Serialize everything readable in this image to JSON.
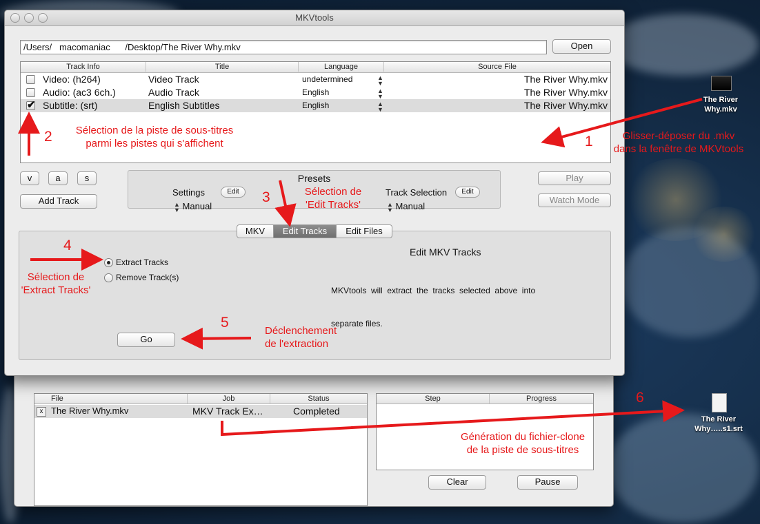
{
  "window": {
    "title": "MKVtools",
    "path_value": "/Users/   macomaniac      /Desktop/The River Why.mkv",
    "open_label": "Open"
  },
  "tracks": {
    "columns": [
      "Track Info",
      "Title",
      "Language",
      "Source File"
    ],
    "rows": [
      {
        "info": "Video: (h264)",
        "title": "Video Track",
        "language": "undetermined",
        "source": "The River Why.mkv",
        "checked": false
      },
      {
        "info": "Audio: (ac3 6ch.)",
        "title": "Audio Track",
        "language": "English",
        "source": "The River Why.mkv",
        "checked": false
      },
      {
        "info": "Subtitle: (srt)",
        "title": "English Subtitles",
        "language": "English",
        "source": "The River Why.mkv",
        "checked": true
      }
    ]
  },
  "buttons": {
    "v": "v",
    "a": "a",
    "s": "s",
    "add_track": "Add Track",
    "play": "Play",
    "watch_mode": "Watch Mode",
    "go": "Go",
    "clear": "Clear",
    "pause": "Pause"
  },
  "presets": {
    "title": "Presets",
    "settings_label": "Settings",
    "settings_edit": "Edit",
    "settings_value": "Manual",
    "track_selection_label": "Track Selection",
    "track_selection_edit": "Edit",
    "track_selection_value": "Manual"
  },
  "tabs": [
    "MKV",
    "Edit Tracks",
    "Edit Files"
  ],
  "edit_panel": {
    "heading": "Edit MKV Tracks",
    "description_line1": "MKVtools  will  extract  the  tracks  selected  above  into",
    "description_line2": "separate files.",
    "option_extract": "Extract Tracks",
    "option_remove": "Remove Track(s)"
  },
  "jobs": {
    "columns": [
      "File",
      "Job",
      "Status"
    ],
    "row": {
      "remove": "x",
      "file": "The River Why.mkv",
      "job": "MKV Track Ex…",
      "status": "Completed"
    },
    "progress_columns": [
      "Step",
      "Progress"
    ]
  },
  "desktop": {
    "mkv_label_1": "The River",
    "mkv_label_2": "Why.mkv",
    "srt_label_1": "The River",
    "srt_label_2": "Why…..s1.srt"
  },
  "annotations": {
    "n1": "1",
    "n2": "2",
    "n3": "3",
    "n4": "4",
    "n5": "5",
    "n6": "6",
    "a1_line1": "Glisser-déposer du .mkv",
    "a1_line2": "dans la fenêtre de MKVtools",
    "a2_line1": "Sélection de la piste de sous-titres",
    "a2_line2": "parmi les pistes qui s'affichent",
    "a3_line1": "Sélection de",
    "a3_line2": "'Edit Tracks'",
    "a4_line1": "Sélection de",
    "a4_line2": "'Extract Tracks'",
    "a5_line1": "Déclenchement",
    "a5_line2": "de l'extraction",
    "a6_line1": "Génération du fichier-clone",
    "a6_line2": "de la piste de sous-titres"
  },
  "colors": {
    "annotation_red": "#e6191b",
    "active_tab": "#7a7a7a"
  }
}
